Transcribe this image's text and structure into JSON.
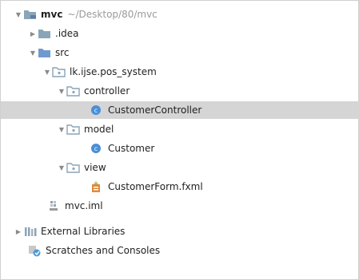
{
  "tree": {
    "project": {
      "name": "mvc",
      "path": "~/Desktop/80/mvc"
    },
    "idea": "idea",
    "src": "src",
    "package": "lk.ijse.pos_system",
    "controller": "controller",
    "customer_controller": "CustomerController",
    "model": "model",
    "customer": "Customer",
    "view": "view",
    "customer_form": "CustomerForm.fxml",
    "iml": "mvc.iml",
    "external_libraries": "External Libraries",
    "scratches": "Scratches and Consoles"
  },
  "colors": {
    "folder": "#8aa4b8",
    "src_folder": "#6f9ad0",
    "class_icon": "#4a8ed8",
    "selection": "#d5d5d5"
  }
}
